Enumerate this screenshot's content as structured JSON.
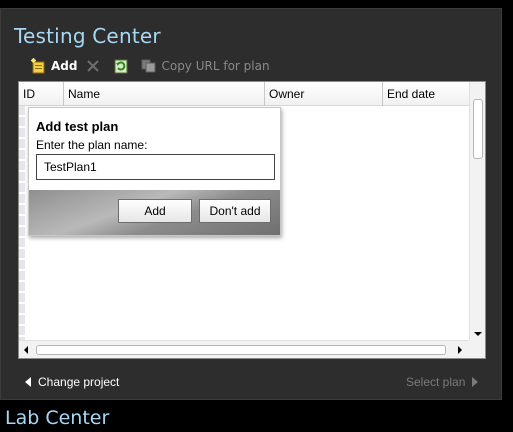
{
  "panel": {
    "title": "Testing Center"
  },
  "toolbar": {
    "add_label": "Add",
    "copy_url_label": "Copy URL for plan"
  },
  "grid": {
    "columns": [
      "ID",
      "Name",
      "Owner",
      "End date"
    ]
  },
  "dialog": {
    "title": "Add test plan",
    "prompt": "Enter the plan name:",
    "input_value": "TestPlan1",
    "add_button": "Add",
    "cancel_button": "Don't add"
  },
  "nav": {
    "change_project": "Change project",
    "select_plan": "Select plan"
  },
  "footer": {
    "lab_center": "Lab Center"
  },
  "colors": {
    "title_blue": "#a6d8f4",
    "panel_bg": "#2d2d2d",
    "disabled_text": "#8a8a8a"
  },
  "icons": {
    "add": "add-plan-icon",
    "delete": "delete-x-icon",
    "refresh": "refresh-icon",
    "copy": "copy-url-icon"
  }
}
